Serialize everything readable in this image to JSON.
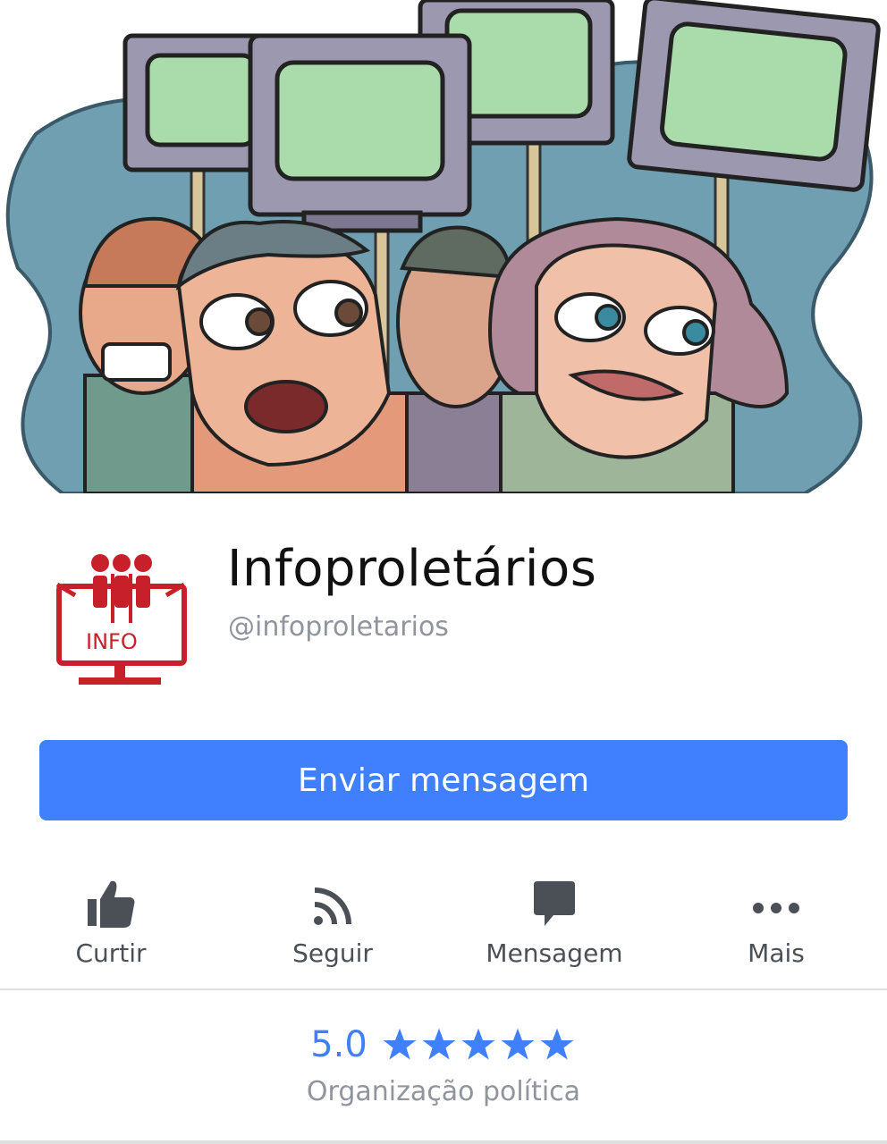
{
  "page": {
    "name": "Infoproletários",
    "handle": "@infoproletarios",
    "logo_text": "INFO"
  },
  "primary_action": {
    "label": "Enviar mensagem"
  },
  "actions": [
    {
      "label": "Curtir",
      "icon": "thumbs-up-icon"
    },
    {
      "label": "Seguir",
      "icon": "rss-icon"
    },
    {
      "label": "Mensagem",
      "icon": "chat-bubble-icon"
    },
    {
      "label": "Mais",
      "icon": "more-dots-icon"
    }
  ],
  "rating": {
    "value": "5.0",
    "stars": 5,
    "category": "Organização política"
  },
  "colors": {
    "accent": "#4080ff",
    "icon": "#4b4f56",
    "muted": "#90949c",
    "logo_red": "#c8202a"
  }
}
